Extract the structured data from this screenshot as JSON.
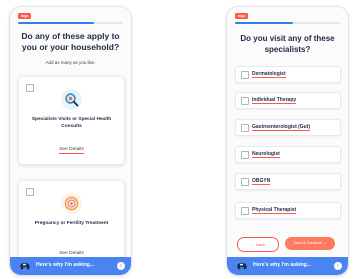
{
  "left_screen": {
    "logo": "logo",
    "title": "Do any of these apply to you or your household?",
    "subtitle": "Add as many as you like.",
    "cards": [
      {
        "title": "Specialists Visits or Special Health Consults",
        "link": "See Details",
        "icon": "magnifier-icon"
      },
      {
        "title": "Pregnancy or Fertility Treatment",
        "link": "See Details",
        "icon": "pregnancy-icon"
      }
    ],
    "bottom_bar": {
      "text": "Here's why I'm asking...",
      "icon": "car-icon",
      "arrow": "›"
    }
  },
  "right_screen": {
    "logo": "logo",
    "title": "Do you visit any of these specialists?",
    "options": [
      "Dermatologist",
      "Individual Therapy",
      "Gastroenterologist (Gut)",
      "Neurologist",
      "OBGYN",
      "Physical Therapist"
    ],
    "back_label": "← Back",
    "continue_label": "Save & Continue →",
    "bottom_bar": {
      "text": "Here's why I'm asking...",
      "icon": "car-icon",
      "arrow": "›"
    }
  },
  "colors": {
    "accent": "#ff5a48",
    "progress": "#2f80ed",
    "bar": "#4a84f2",
    "heading": "#1f2a44"
  },
  "progress": {
    "left": 0.72,
    "right": 0.55
  }
}
